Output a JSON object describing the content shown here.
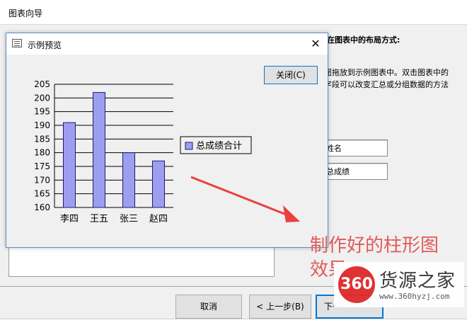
{
  "wizard": {
    "title": "图表向导",
    "instruction_line1": "在图表中的布局方式:",
    "instruction_line2": "钮拖放到示例图表中。双击图表中的",
    "instruction_line3": "字段可以改变汇总或分组数据的方法",
    "field_buttons": [
      "姓名",
      "总成绩"
    ],
    "buttons": {
      "cancel": "取消",
      "back": "< 上一步(B)",
      "next": "下一"
    }
  },
  "dialog": {
    "title": "示例预览",
    "close_x": "✕",
    "close_button": "关闭(C)"
  },
  "chart_data": {
    "type": "bar",
    "categories": [
      "李四",
      "王五",
      "张三",
      "赵四"
    ],
    "series": [
      {
        "name": "总成绩合计",
        "values": [
          191,
          202,
          180,
          177
        ]
      }
    ],
    "y_ticks": [
      160,
      165,
      170,
      175,
      180,
      185,
      190,
      195,
      200,
      205
    ],
    "ylim": [
      160,
      205
    ],
    "grid": true,
    "legend_position": "right",
    "bar_color": "#9e9ef0",
    "bar_edge": "#1c1c74"
  },
  "annotation": {
    "line1": "制作好的柱形图",
    "line2": "效果",
    "color": "#e05a57"
  },
  "watermark": {
    "badge": "360",
    "name": "货源之家",
    "url": "www.360hyzj.com"
  }
}
